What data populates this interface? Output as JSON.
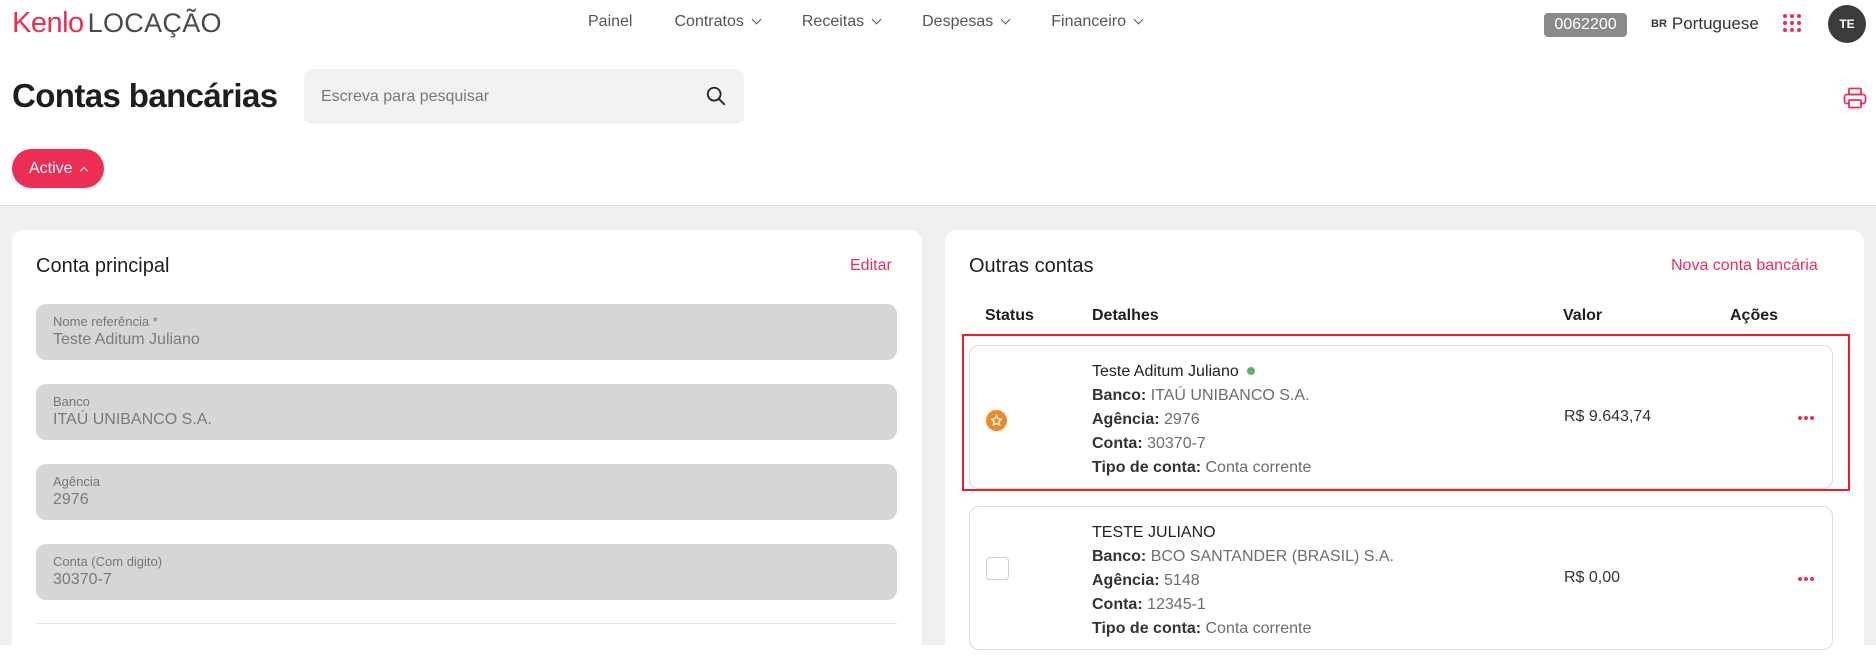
{
  "header": {
    "logo_brand": "Kenlo",
    "logo_product": "LOCAÇÃO",
    "nav": [
      {
        "label": "Painel",
        "has_dropdown": false
      },
      {
        "label": "Contratos",
        "has_dropdown": true
      },
      {
        "label": "Receitas",
        "has_dropdown": true
      },
      {
        "label": "Despesas",
        "has_dropdown": true
      },
      {
        "label": "Financeiro",
        "has_dropdown": true
      }
    ],
    "code": "0062200",
    "language_flag": "BR",
    "language": "Portuguese",
    "avatar_initials": "TE"
  },
  "page": {
    "title": "Contas bancárias",
    "search_placeholder": "Escreva para pesquisar",
    "filter_label": "Active"
  },
  "main_account": {
    "title": "Conta principal",
    "edit_label": "Editar",
    "fields": [
      {
        "label": "Nome referência *",
        "value": "Teste Aditum Juliano"
      },
      {
        "label": "Banco",
        "value": "ITAÚ UNIBANCO S.A."
      },
      {
        "label": "Agência",
        "value": "2976"
      },
      {
        "label": "Conta (Com digito)",
        "value": "30370-7"
      }
    ]
  },
  "other_accounts": {
    "title": "Outras contas",
    "new_label": "Nova conta bancária",
    "columns": {
      "status": "Status",
      "details": "Detalhes",
      "value": "Valor",
      "actions": "Ações"
    },
    "rows": [
      {
        "name": "Teste Aditum Juliano",
        "active_indicator": true,
        "status_icon": "star-icon",
        "bank_label": "Banco:",
        "bank": "ITAÚ UNIBANCO S.A.",
        "agency_label": "Agência:",
        "agency": "2976",
        "account_label": "Conta:",
        "account": "30370-7",
        "type_label": "Tipo de conta:",
        "type": "Conta corrente",
        "value": "R$ 9.643,74"
      },
      {
        "name": "TESTE JULIANO",
        "active_indicator": false,
        "status_icon": "checkbox",
        "bank_label": "Banco:",
        "bank": "BCO SANTANDER (BRASIL) S.A.",
        "agency_label": "Agência:",
        "agency": "5148",
        "account_label": "Conta:",
        "account": "12345-1",
        "type_label": "Tipo de conta:",
        "type": "Conta corrente",
        "value": "R$ 0,00"
      }
    ]
  },
  "colors": {
    "accent": "#ee2d55",
    "highlight": "#ee1c25",
    "status_star": "#f08a24",
    "active_dot": "#5cb85c"
  }
}
